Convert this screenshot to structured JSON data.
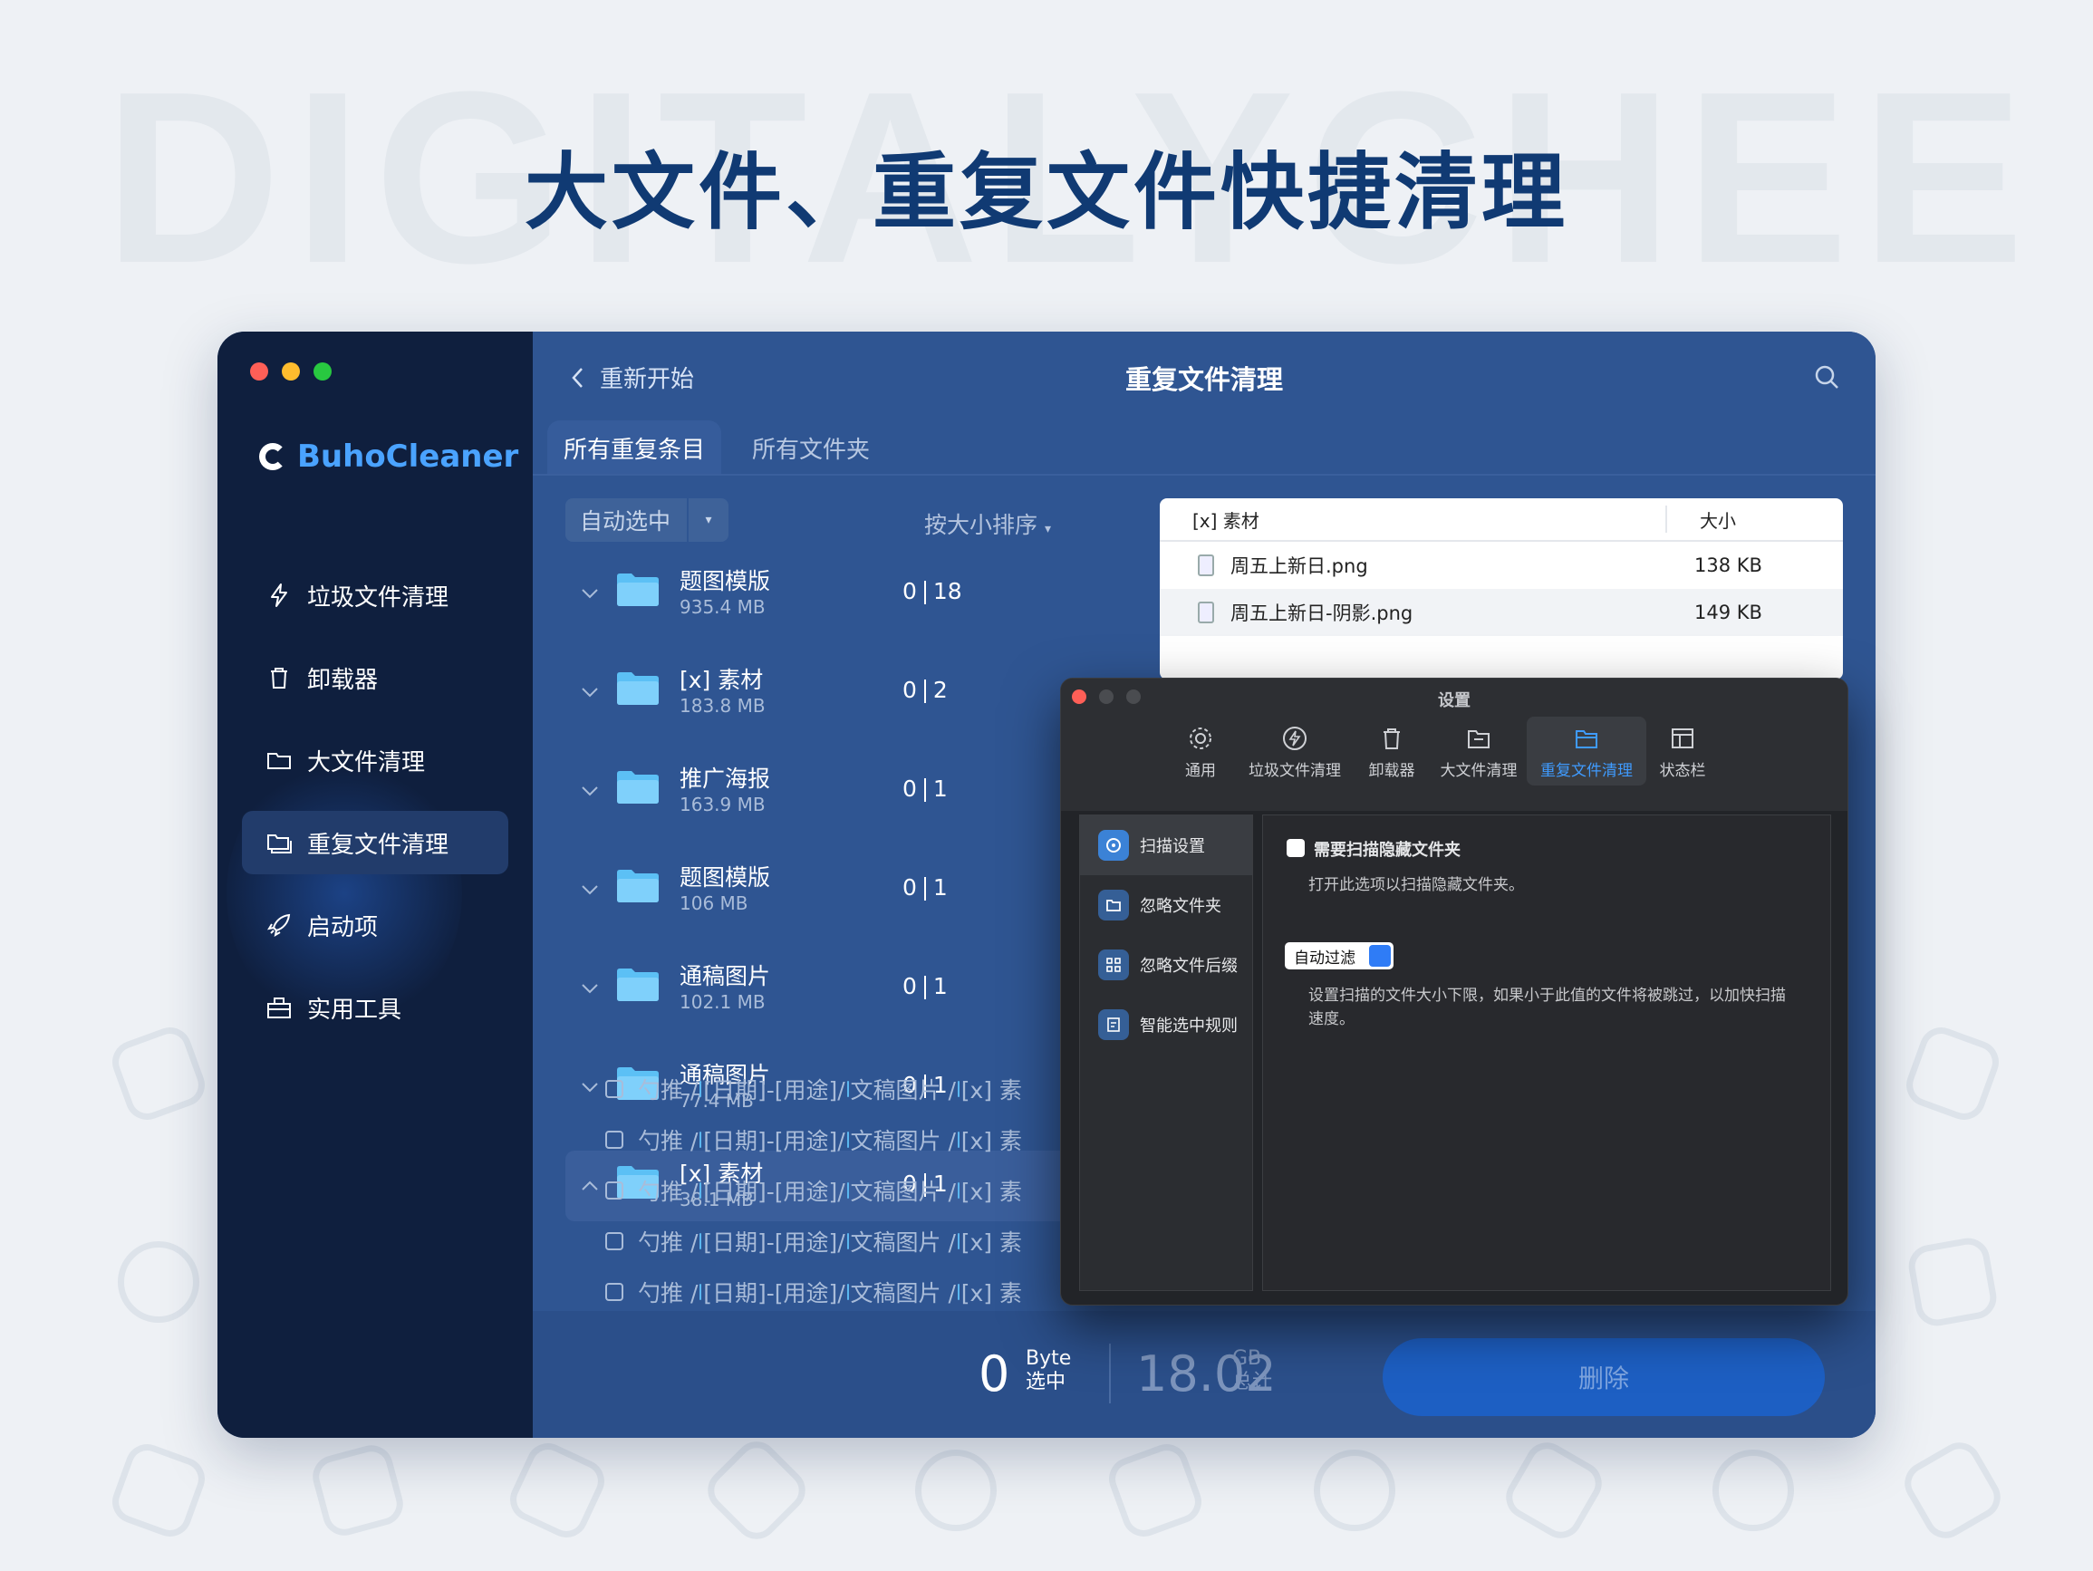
{
  "watermark": "DIGITALYCHEE",
  "headline": "大文件、重复文件快捷清理",
  "sidebar": {
    "logo": "BuhoCleaner",
    "items": [
      {
        "label": "垃圾文件清理",
        "icon": "bolt-icon"
      },
      {
        "label": "卸载器",
        "icon": "trash-icon"
      },
      {
        "label": "大文件清理",
        "icon": "folder-icon"
      },
      {
        "label": "重复文件清理",
        "icon": "duplicate-folder-icon",
        "active": true
      },
      {
        "label": "启动项",
        "icon": "rocket-icon"
      },
      {
        "label": "实用工具",
        "icon": "toolbox-icon"
      }
    ]
  },
  "header": {
    "back_label": "重新开始",
    "title": "重复文件清理"
  },
  "tabs": [
    "所有重复条目",
    "所有文件夹"
  ],
  "toolbar": {
    "auto_select": "自动选中",
    "sort_label": "按大小排序"
  },
  "groups": [
    {
      "name": "题图模版",
      "size": "935.4 MB",
      "selected": "0",
      "count": "18"
    },
    {
      "name": "[x] 素材",
      "size": "183.8 MB",
      "selected": "0",
      "count": "2"
    },
    {
      "name": "推广海报",
      "size": "163.9 MB",
      "selected": "0",
      "count": "1"
    },
    {
      "name": "题图模版",
      "size": "106 MB",
      "selected": "0",
      "count": "1"
    },
    {
      "name": "通稿图片",
      "size": "102.1 MB",
      "selected": "0",
      "count": "1"
    },
    {
      "name": "通稿图片",
      "size": "77.4 MB",
      "selected": "0",
      "count": "1"
    },
    {
      "name": "[x] 素材",
      "size": "38.1 MB",
      "selected": "0",
      "count": "1",
      "expanded": true
    }
  ],
  "paths": [
    {
      "a": "勺推 /",
      "b": "[日期]-[用途]/",
      "c": "文稿图片 /",
      "d": "[x] 素"
    },
    {
      "a": "勺推 /",
      "b": "[日期]-[用途]/",
      "c": "文稿图片 /",
      "d": "[x] 素"
    },
    {
      "a": "勺推 /",
      "b": "[日期]-[用途]/",
      "c": "文稿图片 /",
      "d": "[x] 素"
    },
    {
      "a": "勺推 /",
      "b": "[日期]-[用途]/",
      "c": "文稿图片 /",
      "d": "[x] 素"
    },
    {
      "a": "勺推 /",
      "b": "[日期]-[用途]/",
      "c": "文稿图片 /",
      "d": "[x] 素"
    }
  ],
  "panel": {
    "col_name": "[x] 素材",
    "col_size": "大小",
    "rows": [
      {
        "name": "周五上新日.png",
        "size": "138 KB"
      },
      {
        "name": "周五上新日-阴影.png",
        "size": "149 KB"
      }
    ]
  },
  "footer": {
    "selected_value": "0",
    "selected_unit": "Byte",
    "selected_label": "选中",
    "total_value": "18.02",
    "total_unit": "GB",
    "total_label": "总计",
    "delete_label": "删除"
  },
  "settings": {
    "title": "设置",
    "tabs": [
      "通用",
      "垃圾文件清理",
      "卸载器",
      "大文件清理",
      "重复文件清理",
      "状态栏"
    ],
    "active_tab": "重复文件清理",
    "nav": [
      "扫描设置",
      "忽略文件夹",
      "忽略文件后缀",
      "智能选中规则"
    ],
    "hidden_option": "需要扫描隐藏文件夹",
    "hidden_desc": "打开此选项以扫描隐藏文件夹。",
    "filter_value": "自动过滤",
    "filter_desc": "设置扫描的文件大小下限，如果小于此值的文件将被跳过，以加快扫描速度。"
  },
  "colors": {
    "sidebar": "#0f1f3e",
    "main": "#2f5592",
    "accent": "#4aa3ff",
    "delete": "#1d5fc3"
  }
}
